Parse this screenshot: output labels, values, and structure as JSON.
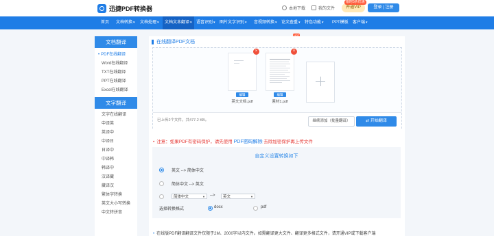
{
  "header": {
    "app_name": "迅捷PDF转换器",
    "links": [
      {
        "label": "本地下载",
        "icon": "download-icon"
      },
      {
        "label": "我的文件",
        "icon": "folder-icon"
      }
    ],
    "vip_label": "开通VIP",
    "vip_badge": "限时5折优惠",
    "login_label": "登录 | 注册"
  },
  "nav": [
    {
      "label": "首页",
      "caret": false
    },
    {
      "label": "文档转换",
      "caret": true
    },
    {
      "label": "文档处理",
      "caret": true
    },
    {
      "label": "文档文本翻译",
      "caret": true,
      "active": true
    },
    {
      "label": "语音识别",
      "caret": true
    },
    {
      "label": "图片文字识别",
      "caret": true
    },
    {
      "label": "音视频转换",
      "caret": true
    },
    {
      "label": "论文查重",
      "caret": true,
      "hot": "HOT"
    },
    {
      "label": "特色功能",
      "caret": true
    },
    {
      "label": "PPT模板",
      "caret": false
    },
    {
      "label": "客户端",
      "caret": true
    }
  ],
  "sidebar": {
    "doc_section": "文档翻译",
    "doc_items": [
      "PDF在线翻译",
      "Word在线翻译",
      "TXT在线翻译",
      "PPT在线翻译",
      "Excel在线翻译"
    ],
    "text_section": "文字翻译",
    "text_items": [
      "文字在线翻译",
      "中译英",
      "英译中",
      "中译日",
      "日译中",
      "中译韩",
      "韩译中",
      "汉译藏",
      "藏译汉",
      "繁体字转换",
      "英文大小写转换",
      "中文转拼音"
    ]
  },
  "main": {
    "title": "在线翻译PDF文档",
    "files": [
      {
        "name": "英文文档.pdf",
        "edit": "编辑"
      },
      {
        "name": "素材1.pdf",
        "edit": "编辑"
      }
    ],
    "upload_info": "已上传2个文件，共477.2 KB。",
    "continue_label": "继续添加（批量翻译）",
    "start_label": "开始翻译",
    "notice_prefix": "注意：如果PDF有密码保护，请先使用",
    "notice_link": "PDF密码解除",
    "notice_suffix": "去除加密保护再上传文件",
    "settings_title": "自定义设置转换如下",
    "option1": "英文 --> 简体中文",
    "option2": "简体中文 --> 英文",
    "select_from": "简体中文",
    "arrow": "-->",
    "select_to": "英文",
    "format_label": "选择转换格式",
    "format_docx": "docx",
    "format_pdf": "pdf",
    "bottom_note": "在线版PDF翻译翻译文件仅限于2M、2000字以内文件。如需翻译更大文件、翻译更多格式文件，请开通VIP或下载客户端"
  }
}
